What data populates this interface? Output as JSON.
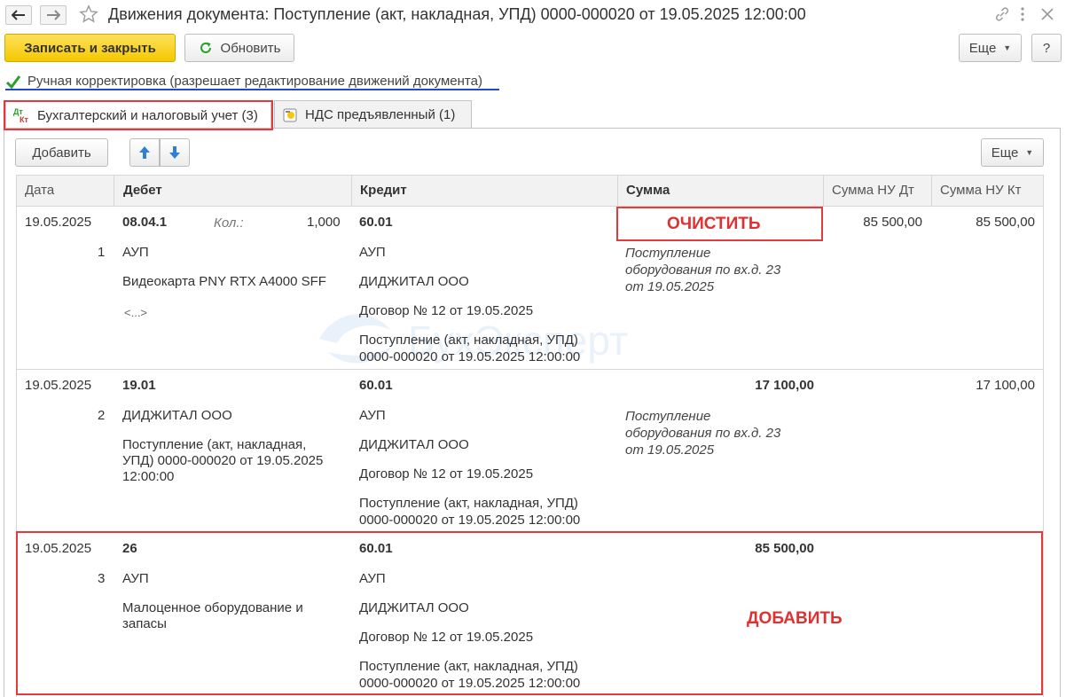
{
  "window": {
    "title": "Движения документа: Поступление (акт, накладная, УПД) 0000-000020 от 19.05.2025 12:00:00"
  },
  "toolbar": {
    "save_close": "Записать и закрыть",
    "refresh": "Обновить",
    "more": "Еще",
    "help": "?"
  },
  "manual_edit": {
    "label": "Ручная корректировка (разрешает редактирование движений документа)",
    "checked": true
  },
  "tabs": [
    {
      "label": "Бухгалтерский и налоговый учет (3)",
      "icon": "dt-kt-icon",
      "active": true
    },
    {
      "label": "НДС предъявленный (1)",
      "icon": "vat-icon",
      "active": false
    }
  ],
  "table_toolbar": {
    "add": "Добавить",
    "more": "Еще"
  },
  "columns": [
    "Дата",
    "Дебет",
    "Кредит",
    "Сумма",
    "Сумма НУ Дт",
    "Сумма НУ Кт"
  ],
  "rows": [
    {
      "date": "19.05.2025",
      "num": "1",
      "debit": [
        "08.04.1",
        "АУП",
        "Видеокарта PNY RTX A4000 SFF",
        "<...>"
      ],
      "qty_label": "Кол.:",
      "qty": "1,000",
      "credit": [
        "60.01",
        "АУП",
        "ДИДЖИТАЛ ООО",
        "Договор № 12 от 19.05.2025",
        "Поступление (акт, накладная, УПД)",
        "0000-000020 от 19.05.2025 12:00:00"
      ],
      "sum": "",
      "content": [
        "Поступление",
        "оборудования по вх.д. 23",
        "от 19.05.2025"
      ],
      "nu_dt": "85 500,00",
      "nu_kt": "85 500,00"
    },
    {
      "date": "19.05.2025",
      "num": "2",
      "debit": [
        "19.01",
        "ДИДЖИТАЛ ООО",
        "Поступление (акт, накладная,",
        "УПД) 0000-000020 от 19.05.2025",
        "12:00:00"
      ],
      "credit": [
        "60.01",
        "АУП",
        "ДИДЖИТАЛ ООО",
        "Договор № 12 от 19.05.2025",
        "Поступление (акт, накладная, УПД)",
        "0000-000020 от 19.05.2025 12:00:00"
      ],
      "sum": "17 100,00",
      "content": [
        "Поступление",
        "оборудования по вх.д. 23",
        "от 19.05.2025"
      ],
      "nu_dt": "",
      "nu_kt": "17 100,00"
    },
    {
      "date": "19.05.2025",
      "num": "3",
      "debit": [
        "26",
        "АУП",
        "Малоценное оборудование и",
        "запасы"
      ],
      "credit": [
        "60.01",
        "АУП",
        "ДИДЖИТАЛ ООО",
        "Договор № 12 от 19.05.2025",
        "Поступление (акт, накладная, УПД)",
        "0000-000020 от 19.05.2025 12:00:00"
      ],
      "sum": "85 500,00",
      "nu_dt": "",
      "nu_kt": ""
    }
  ],
  "annotations": {
    "clear": "ОЧИСТИТЬ",
    "add": "ДОБАВИТЬ"
  },
  "watermark": "БухЭксперт",
  "colors": {
    "primary_button": "#f5c800",
    "annotation_red": "#e13b3b",
    "underline_blue": "#2446c8",
    "checkbox_green": "#2aa02a"
  }
}
